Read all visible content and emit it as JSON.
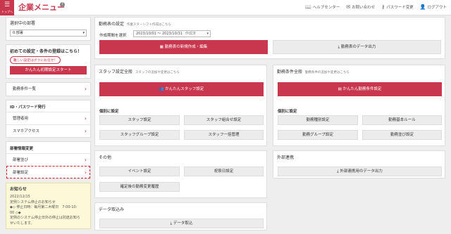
{
  "header": {
    "menu_label": "トップへ",
    "title": "企業メニュー",
    "help_mark": "?",
    "links": [
      {
        "icon": "book-icon",
        "glyph": "📖",
        "label": "ヘルプセンター"
      },
      {
        "icon": "mail-icon",
        "glyph": "✉",
        "label": "お問い合わせ"
      },
      {
        "icon": "key-icon",
        "glyph": "⚷",
        "label": "パスワード変更"
      },
      {
        "icon": "user-icon",
        "glyph": "👤",
        "label": "ログアウト"
      }
    ]
  },
  "sidebar": {
    "dept_title": "選択中の部署",
    "dept_value": "0:部署",
    "init_title": "初めての設定・条件の登録はこちら！",
    "init_link": "難しい設定はボクにお任せ！",
    "init_button": "かんたん初期設定スタート",
    "conditions_item": "勤務条件一覧",
    "id_section": "ID・パスワード発行",
    "id_items": [
      "管理者用",
      "スマホアクセス"
    ],
    "dept_section": "部署情報変更",
    "dept_items": [
      "部署並び",
      "部署設定"
    ],
    "notice": {
      "title": "お知らせ",
      "lines": [
        "2022/12/15",
        "定例システム停止のお知らせ",
        "◆◇ 停止日時：毎月第二木曜日　7:00-10:",
        "00 ◇◆",
        "定例のシステム停止日外の停止は別途お知ら",
        "せいたします。"
      ]
    }
  },
  "schedule": {
    "title": "勤務表の設定",
    "note": "作業スタ・シフト作成はこちら",
    "period_label": "作成期間を選択",
    "period_value": "2023/10/01 ～ 2023/10/31",
    "period_tag": "作成済",
    "create_button": "勤務表の新規作成・編集",
    "export_button": "勤務表のデータ出力"
  },
  "staff": {
    "title": "スタッフ設定全般",
    "note": "スタッフの追加や変更はこちら",
    "main_button": "かんたんスタッフ設定",
    "sub_head": "個別に設定",
    "buttons": [
      "スタッフ設定",
      "スタッフ組合せ設定",
      "スタッフグループ設定",
      "スタッフ一括管理"
    ]
  },
  "conditions": {
    "title": "勤務条件全般",
    "note": "勤務条件の追加や変更はこちら",
    "main_button": "かんたん勤務条件設定",
    "sub_head": "個別に設定",
    "buttons": [
      "勤務種別設定",
      "勤務基本ルール",
      "勤務グループ設定",
      "勤務並び設定"
    ]
  },
  "other": {
    "title": "その他",
    "buttons": [
      "イベント設定",
      "祝祭日設定",
      "確定後の勤務変更履歴"
    ]
  },
  "external": {
    "title": "外部連携",
    "button": "外部連携用のデータ出力"
  },
  "data_import": {
    "title": "データ取込み",
    "button": "データ取込"
  },
  "colors": {
    "accent": "#c8374e",
    "highlight_dashed": "#e0202a",
    "notice_bg": "#fdf8d8"
  }
}
